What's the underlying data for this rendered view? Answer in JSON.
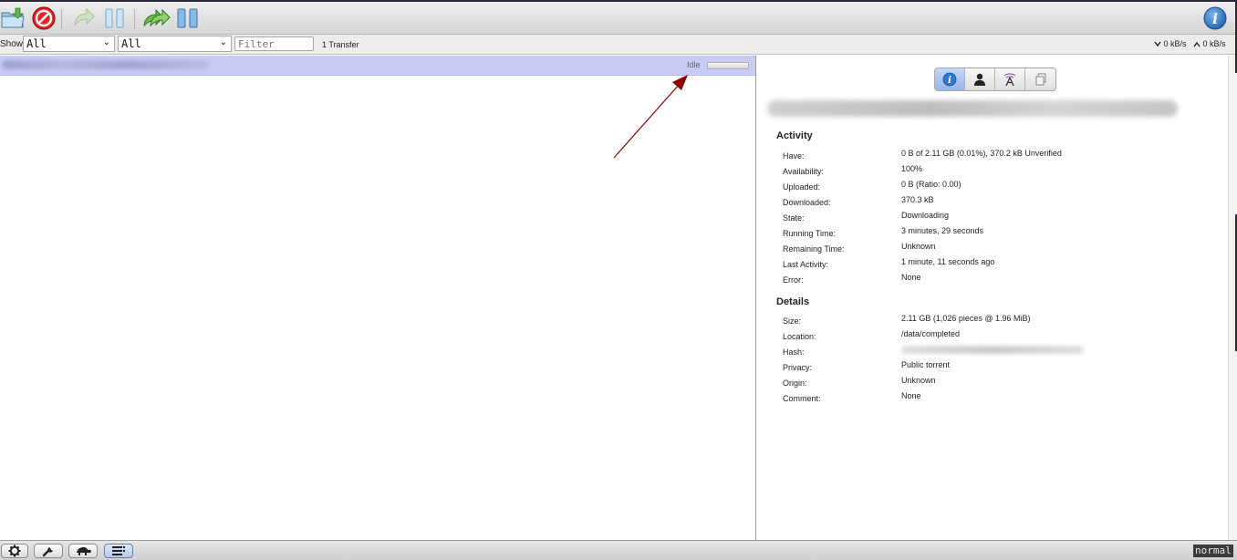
{
  "filterbar": {
    "show_label": "Show",
    "status_filter": "All",
    "tracker_filter": "All",
    "search_placeholder": "Filter",
    "transfer_count": "1 Transfer",
    "download_speed": "0 kB/s",
    "upload_speed": "0 kB/s"
  },
  "transfer": {
    "status": "Idle",
    "progress_fraction": 0.0001
  },
  "inspector": {
    "tabs": [
      "info-icon",
      "peers-icon",
      "trackers-icon",
      "files-icon"
    ],
    "activity": {
      "title": "Activity",
      "rows": [
        {
          "key": "Have:",
          "value": "0 B of 2.11 GB (0.01%), 370.2 kB Unverified"
        },
        {
          "key": "Availability:",
          "value": "100%"
        },
        {
          "key": "Uploaded:",
          "value": "0 B (Ratio: 0.00)"
        },
        {
          "key": "Downloaded:",
          "value": "370.3 kB"
        },
        {
          "key": "State:",
          "value": "Downloading"
        },
        {
          "key": "Running Time:",
          "value": "3 minutes, 29 seconds"
        },
        {
          "key": "Remaining Time:",
          "value": "Unknown"
        },
        {
          "key": "Last Activity:",
          "value": "1 minute, 11 seconds ago"
        },
        {
          "key": "Error:",
          "value": "None"
        }
      ]
    },
    "details": {
      "title": "Details",
      "rows": [
        {
          "key": "Size:",
          "value": "2.11 GB (1,026 pieces @ 1.96 MiB)"
        },
        {
          "key": "Location:",
          "value": "/data/completed"
        },
        {
          "key": "Hash:",
          "value": ""
        },
        {
          "key": "Privacy:",
          "value": "Public torrent"
        },
        {
          "key": "Origin:",
          "value": "Unknown"
        },
        {
          "key": "Comment:",
          "value": "None"
        }
      ]
    }
  },
  "statusbar": {
    "mode": "normal"
  },
  "colors": {
    "selected_row": "#c8ccf4",
    "annotation_arrow": "#8b0000",
    "active_tab": "#97b5e6"
  }
}
